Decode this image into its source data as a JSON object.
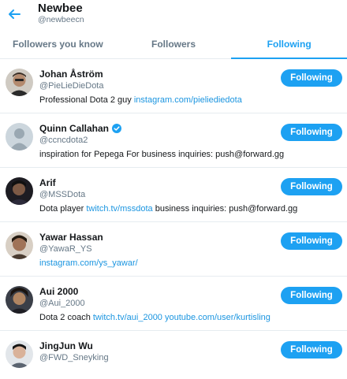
{
  "header": {
    "title": "Newbee",
    "handle": "@newbeecn"
  },
  "tabs": [
    {
      "label": "Followers you know"
    },
    {
      "label": "Followers"
    },
    {
      "label": "Following"
    }
  ],
  "colors": {
    "accent": "#1da1f2",
    "link": "#1b95e0"
  },
  "users": [
    {
      "name": "Johan Åström",
      "handle": "@PieLieDieDota",
      "bio_text": "Professional Dota 2 guy ",
      "bio_link": "instagram.com/pieliediedota",
      "bio_rest": "",
      "button": "Following",
      "verified": false
    },
    {
      "name": "Quinn Callahan",
      "handle": "@ccncdota2",
      "bio_text": "inspiration for Pepega For business inquiries: push@forward.gg",
      "bio_link": "",
      "bio_rest": "",
      "button": "Following",
      "verified": true
    },
    {
      "name": "Arif",
      "handle": "@MSSDota",
      "bio_text": "Dota player ",
      "bio_link": "twitch.tv/mssdota",
      "bio_rest": " business inquiries: push@forward.gg",
      "button": "Following",
      "verified": false
    },
    {
      "name": "Yawar Hassan",
      "handle": "@YawaR_YS",
      "bio_text": "",
      "bio_link": "instagram.com/ys_yawar/",
      "bio_rest": "",
      "button": "Following",
      "verified": false
    },
    {
      "name": "Aui 2000",
      "handle": "@Aui_2000",
      "bio_text": "Dota 2 coach ",
      "bio_link": "twitch.tv/aui_2000 youtube.com/user/kurtisling",
      "bio_rest": "",
      "button": "Following",
      "verified": false
    },
    {
      "name": "JingJun Wu",
      "handle": "@FWD_Sneyking",
      "bio_text": "",
      "bio_link": "",
      "bio_rest": "",
      "button": "Following",
      "verified": false
    }
  ]
}
